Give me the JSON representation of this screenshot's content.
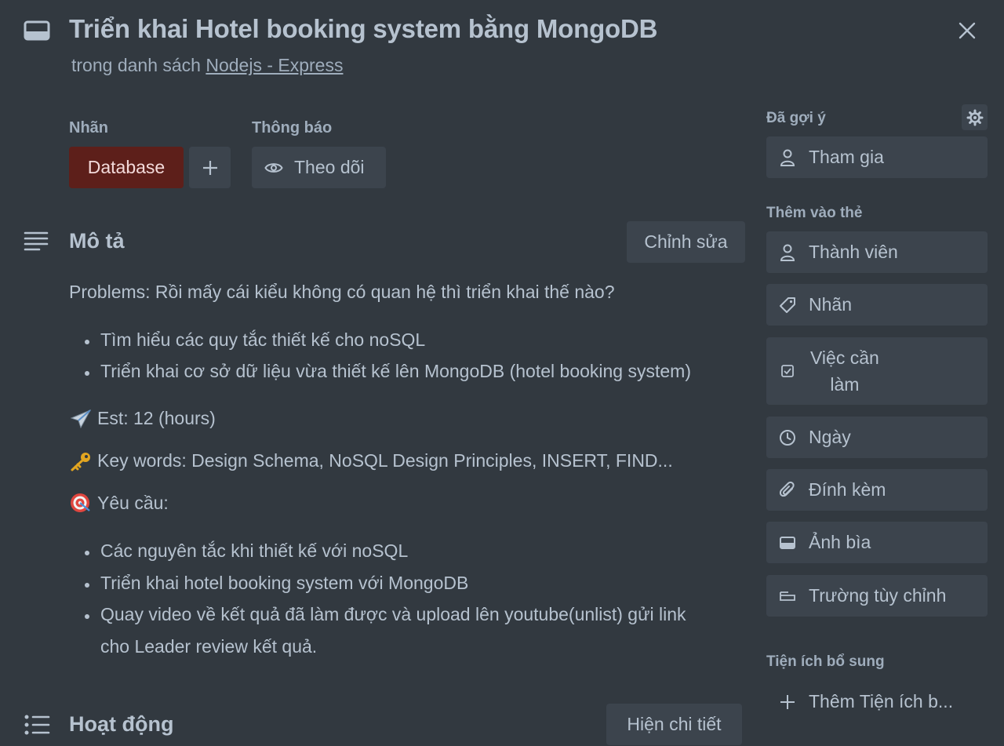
{
  "header": {
    "title": "Triển khai Hotel booking system bằng MongoDB",
    "subtitle_prefix": "trong danh sách",
    "list_name": "Nodejs - Express"
  },
  "labels_section": {
    "heading": "Nhãn",
    "label_name": "Database",
    "label_color": "#5d1f1a"
  },
  "notifications_section": {
    "heading": "Thông báo",
    "watch_label": "Theo dõi"
  },
  "description": {
    "heading": "Mô tả",
    "edit_label": "Chỉnh sửa",
    "problems": "Problems: Rồi mấy cái kiểu không có quan hệ thì triển khai thế nào?",
    "bullets1": [
      "Tìm hiểu các quy tắc thiết kế cho noSQL",
      "Triển khai cơ sở dữ liệu vừa thiết kế lên MongoDB (hotel booking system)"
    ],
    "est": "Est: 12 (hours)",
    "keywords": "Key words: Design Schema, NoSQL Design Principles, INSERT, FIND...",
    "requirements": "Yêu cầu:",
    "bullets2": [
      "Các nguyên tắc khi thiết kế với noSQL",
      "Triển khai hotel booking system với MongoDB",
      "Quay video về kết quả đã làm được và upload lên youtube(unlist) gửi link",
      "cho Leader review kết quả."
    ]
  },
  "activity": {
    "heading": "Hoạt động",
    "show_details_label": "Hiện chi tiết"
  },
  "sidebar": {
    "suggested_heading": "Đã gợi ý",
    "join_label": "Tham gia",
    "add_to_card_heading": "Thêm vào thẻ",
    "members_label": "Thành viên",
    "labels_label": "Nhãn",
    "checklist_line1": "Việc cần",
    "checklist_line2": "làm",
    "dates_label": "Ngày",
    "attachment_label": "Đính kèm",
    "cover_label": "Ảnh bìa",
    "custom_fields_label": "Trường tùy chỉnh",
    "powerups_heading": "Tiện ích bổ sung",
    "add_powerup_label": "Thêm Tiện ích b..."
  },
  "colors": {
    "background": "#323940",
    "button": "#3c444d",
    "text": "#b6c2cf",
    "muted": "#9fadbc"
  }
}
